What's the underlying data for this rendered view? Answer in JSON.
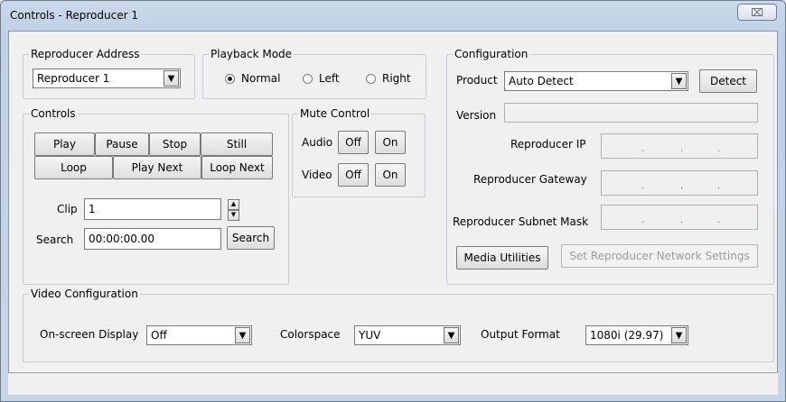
{
  "window": {
    "title": "Controls - Reproducer 1",
    "close_glyph": "⌧"
  },
  "reproducer_address": {
    "label": "Reproducer Address",
    "selected": "Reproducer 1"
  },
  "playback_mode": {
    "label": "Playback Mode",
    "options": [
      "Normal",
      "Left",
      "Right"
    ],
    "selected": "Normal"
  },
  "controls": {
    "label": "Controls",
    "play": "Play",
    "pause": "Pause",
    "stop": "Stop",
    "still": "Still",
    "loop": "Loop",
    "play_next": "Play Next",
    "loop_next": "Loop Next",
    "clip_label": "Clip",
    "clip_value": "1",
    "search_label": "Search",
    "search_value": "00:00:00.00",
    "search_button": "Search"
  },
  "mute_control": {
    "label": "Mute Control",
    "audio": "Audio",
    "video": "Video",
    "off": "Off",
    "on": "On"
  },
  "configuration": {
    "label": "Configuration",
    "product_label": "Product",
    "product_value": "Auto Detect",
    "detect_button": "Detect",
    "version_label": "Version",
    "version_value": "",
    "ip_label": "Reproducer IP",
    "gateway_label": "Reproducer Gateway",
    "subnet_label": "Reproducer Subnet Mask",
    "ip_dot": ".",
    "media_utilities": "Media Utilities",
    "set_network": "Set Reproducer Network Settings"
  },
  "video_configuration": {
    "label": "Video Configuration",
    "osd_label": "On-screen Display",
    "osd_value": "Off",
    "colorspace_label": "Colorspace",
    "colorspace_value": "YUV",
    "output_label": "Output Format",
    "output_value": "1080i (29.97)"
  },
  "icons": {
    "dropdown": "▼",
    "spin_up": "▲",
    "spin_down": "▼"
  }
}
